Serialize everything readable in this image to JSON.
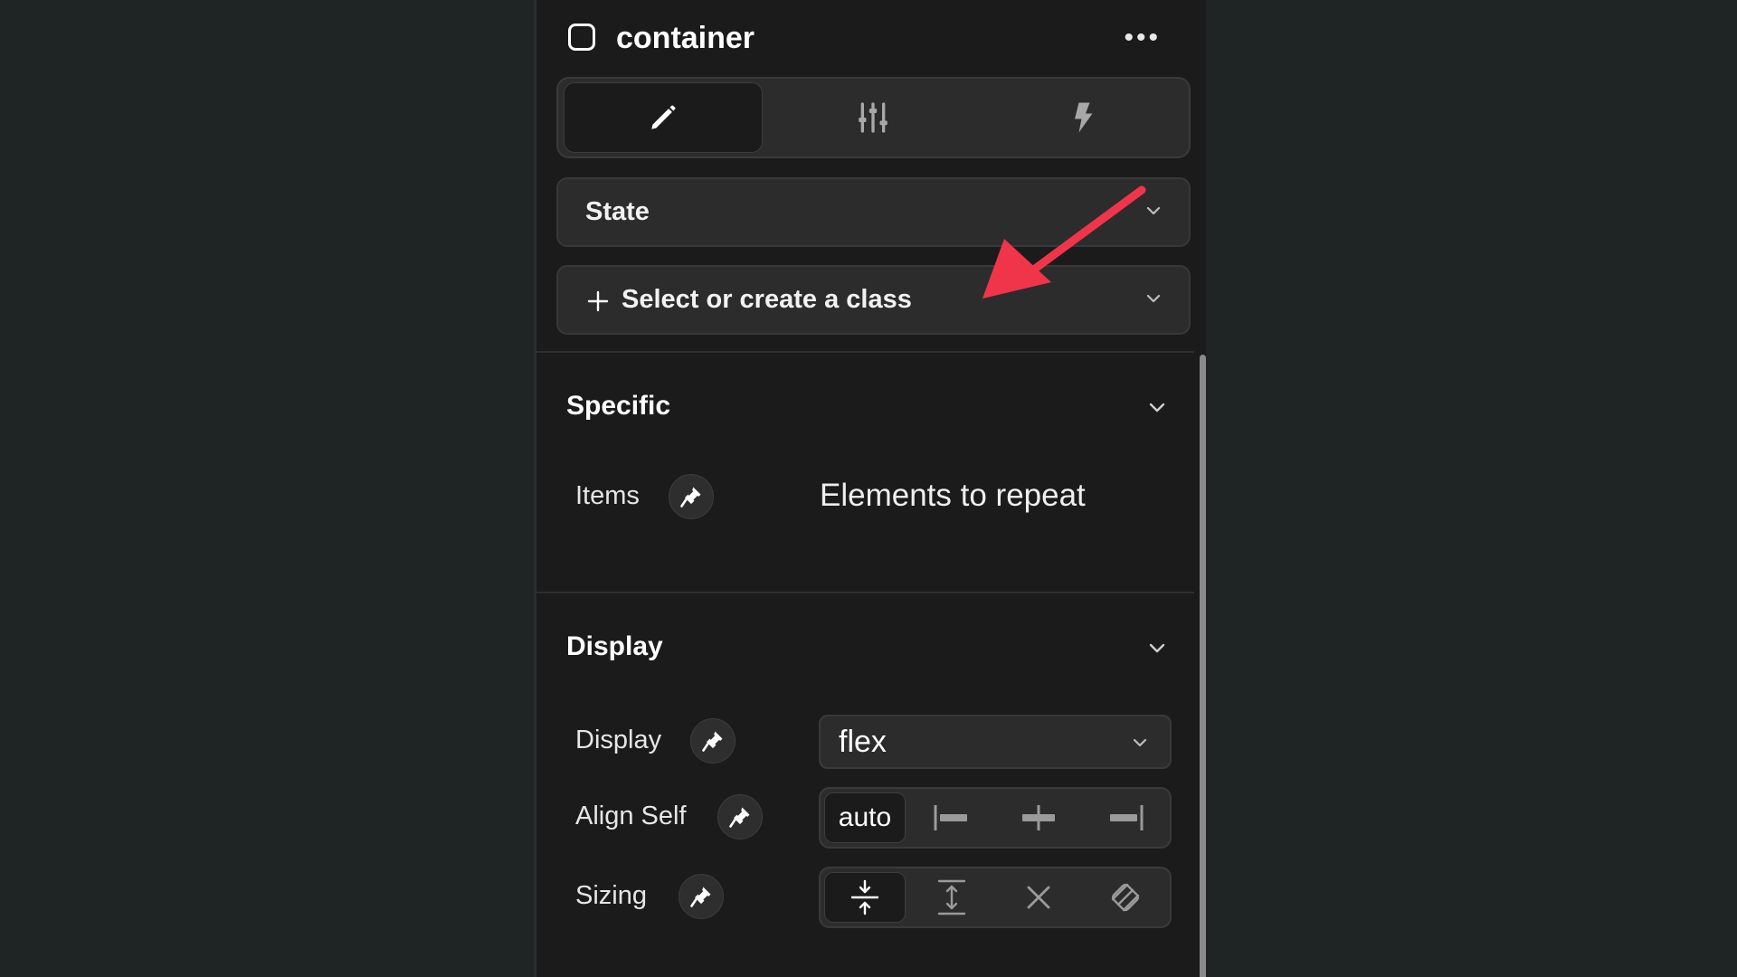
{
  "header": {
    "title": "container",
    "more_label": "•••"
  },
  "tabs": [
    {
      "name": "style",
      "icon": "pencil-icon",
      "active": true
    },
    {
      "name": "settings",
      "icon": "sliders-icon",
      "active": false
    },
    {
      "name": "interactions",
      "icon": "lightning-icon",
      "active": false
    }
  ],
  "state_dropdown": {
    "label": "State"
  },
  "class_selector": {
    "label": "Select or create a class",
    "icon": "plus-icon"
  },
  "sections": {
    "specific": {
      "title": "Specific",
      "items_label": "Items",
      "items_value": "Elements to repeat"
    },
    "display": {
      "title": "Display",
      "display_label": "Display",
      "display_value": "flex",
      "align_self_label": "Align Self",
      "align_self_options": [
        "auto",
        "align-start-icon",
        "align-center-icon",
        "align-end-icon"
      ],
      "align_self_selected": "auto",
      "sizing_label": "Sizing",
      "sizing_options": [
        "shrink-icon",
        "grow-icon",
        "none-icon",
        "custom-icon"
      ],
      "sizing_selected": "shrink-icon"
    }
  },
  "annotation": {
    "color": "#f0354a",
    "icon": "arrow-annotation"
  },
  "colors": {
    "background": "#1f2424",
    "panel": "#1b1b1b",
    "control": "#2c2c2c",
    "accent_arrow": "#f0354a"
  }
}
